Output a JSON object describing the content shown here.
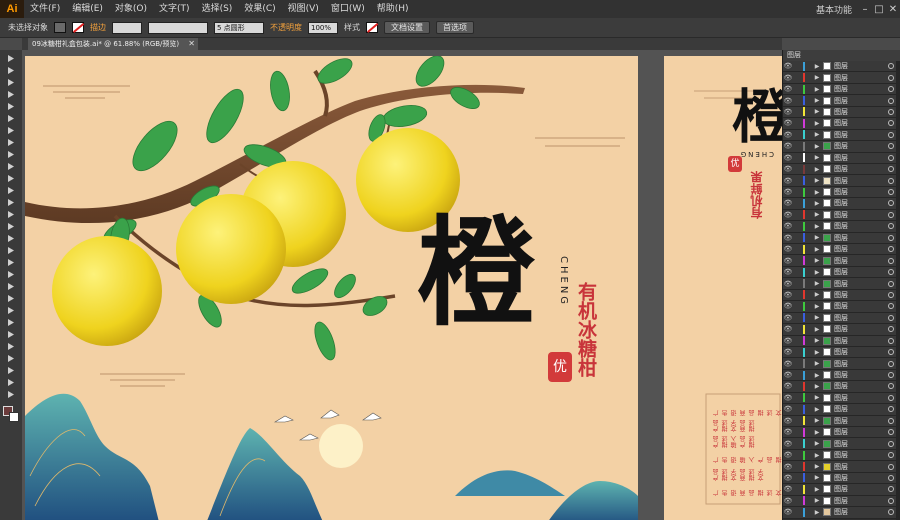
{
  "app": {
    "logo": "Ai",
    "menus": [
      "文件(F)",
      "编辑(E)",
      "对象(O)",
      "文字(T)",
      "选择(S)",
      "效果(C)",
      "视图(V)",
      "窗口(W)",
      "帮助(H)"
    ],
    "workspace": "基本功能",
    "window_controls": [
      "–",
      "□",
      "✕"
    ]
  },
  "control_bar": {
    "selection": "未选择对象",
    "stroke_label": "描边",
    "point_label": "5 点圆形",
    "opacity_label": "不透明度",
    "opacity_value": "100%",
    "style_label": "样式",
    "doc_setup": "文档设置",
    "preferences": "首选项"
  },
  "document_tab": {
    "title": "09冰糖柑礼盒包装.ai* @ 61.88% (RGB/预览)",
    "close": "✕"
  },
  "tools": [
    "selection-tool",
    "direct-selection-tool",
    "magic-wand-tool",
    "lasso-tool",
    "pen-tool",
    "curvature-tool",
    "type-tool",
    "line-tool",
    "rectangle-tool",
    "paintbrush-tool",
    "pencil-tool",
    "shaper-tool",
    "eraser-tool",
    "rotate-tool",
    "scale-tool",
    "width-tool",
    "free-transform-tool",
    "shape-builder-tool",
    "perspective-grid-tool",
    "mesh-tool",
    "gradient-tool",
    "eyedropper-tool",
    "blend-tool",
    "symbol-sprayer-tool",
    "column-graph-tool",
    "artboard-tool",
    "slice-tool",
    "hand-tool",
    "zoom-tool"
  ],
  "artwork": {
    "title_char": "橙",
    "pinyin": "CHENG",
    "subtitle": "有机冰糖柑",
    "seal": "优",
    "side_title_char": "橙",
    "side_pinyin": "CHENG",
    "side_subtitle": "有机鲜果",
    "side_seal": "优",
    "side_text_lines": [
      "广告语 商品描述文字",
      "产品描述文字 商品描述",
      "产品描述 输入产品描述",
      "广告语 输入产品描述",
      "产品描述文字 商品描述文字",
      "广告语 商品描述文字"
    ]
  },
  "layers_panel": {
    "title": "图层",
    "layer_name": "图层",
    "rows": [
      {
        "color": "#3aa0d8",
        "thumb": "#ffffff"
      },
      {
        "color": "#e0372e",
        "thumb": "#ffffff"
      },
      {
        "color": "#3ec93e",
        "thumb": "#ffffff"
      },
      {
        "color": "#3a5fe0",
        "thumb": "#ffffff"
      },
      {
        "color": "#f2e637",
        "thumb": "#ffffff"
      },
      {
        "color": "#d03ad8",
        "thumb": "#ffffff"
      },
      {
        "color": "#3ad0d0",
        "thumb": "#ffffff"
      },
      {
        "color": "#7a7a7a",
        "thumb": "#3aa24a"
      },
      {
        "color": "#ffffff",
        "thumb": "#ffffff"
      },
      {
        "color": "#7a3a3a",
        "thumb": "#ffffff"
      },
      {
        "color": "#3a5fe0",
        "thumb": "#efe4c5"
      },
      {
        "color": "#3ec93e",
        "thumb": "#ffffff"
      },
      {
        "color": "#3aa0d8",
        "thumb": "#ffffff"
      },
      {
        "color": "#e0372e",
        "thumb": "#ffffff"
      },
      {
        "color": "#3ec93e",
        "thumb": "#ffffff"
      },
      {
        "color": "#3a5fe0",
        "thumb": "#3aa24a"
      },
      {
        "color": "#f2e637",
        "thumb": "#ffffff"
      },
      {
        "color": "#d03ad8",
        "thumb": "#3aa24a"
      },
      {
        "color": "#3ad0d0",
        "thumb": "#ffffff"
      },
      {
        "color": "#7a7a7a",
        "thumb": "#3aa24a"
      },
      {
        "color": "#e0372e",
        "thumb": "#ffffff"
      },
      {
        "color": "#3ec93e",
        "thumb": "#ffffff"
      },
      {
        "color": "#3a5fe0",
        "thumb": "#ffffff"
      },
      {
        "color": "#f2e637",
        "thumb": "#ffffff"
      },
      {
        "color": "#d03ad8",
        "thumb": "#3aa24a"
      },
      {
        "color": "#3ad0d0",
        "thumb": "#ffffff"
      },
      {
        "color": "#7a7a7a",
        "thumb": "#3aa24a"
      },
      {
        "color": "#3aa0d8",
        "thumb": "#ffffff"
      },
      {
        "color": "#e0372e",
        "thumb": "#3aa24a"
      },
      {
        "color": "#3ec93e",
        "thumb": "#ffffff"
      },
      {
        "color": "#3a5fe0",
        "thumb": "#ffffff"
      },
      {
        "color": "#f2e637",
        "thumb": "#3aa24a"
      },
      {
        "color": "#d03ad8",
        "thumb": "#ffffff"
      },
      {
        "color": "#3ad0d0",
        "thumb": "#3aa24a"
      },
      {
        "color": "#3ec93e",
        "thumb": "#ffffff"
      },
      {
        "color": "#e0372e",
        "thumb": "#e3cf2a"
      },
      {
        "color": "#3a5fe0",
        "thumb": "#ffffff"
      },
      {
        "color": "#f2e637",
        "thumb": "#ffffff"
      },
      {
        "color": "#d03ad8",
        "thumb": "#ffffff"
      },
      {
        "color": "#3aa0d8",
        "thumb": "#e3c79d"
      }
    ]
  }
}
